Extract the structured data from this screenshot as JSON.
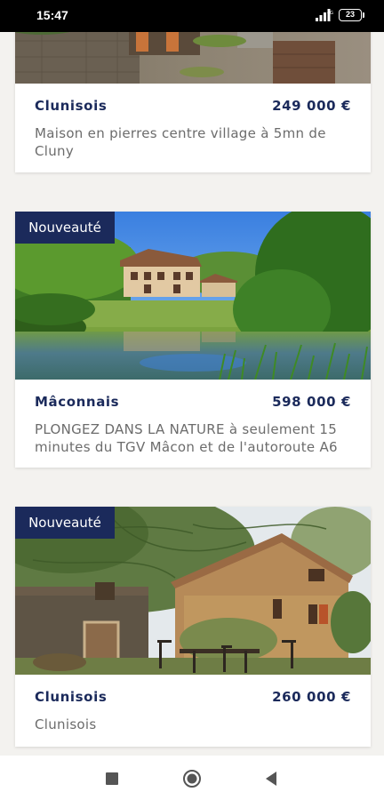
{
  "status_bar": {
    "time": "15:47",
    "battery": "23",
    "icons": [
      "signal-icon",
      "battery-icon"
    ]
  },
  "listings": [
    {
      "badge": "",
      "location": "Clunisois",
      "price": "249 000 €",
      "description": "Maison en pierres centre village à 5mn de Cluny"
    },
    {
      "badge": "Nouveauté",
      "location": "Mâconnais",
      "price": "598 000 €",
      "description": "PLONGEZ DANS LA NATURE à seulement 15 minutes du TGV Mâcon et de l'autoroute A6"
    },
    {
      "badge": "Nouveauté",
      "location": "Clunisois",
      "price": "260 000 €",
      "description": "Clunisois"
    }
  ],
  "nav_bar": {
    "icons": [
      "recents-icon",
      "home-icon",
      "back-icon"
    ]
  },
  "colors": {
    "brand_navy": "#1b2a5b",
    "page_bg": "#f3f2ef"
  }
}
